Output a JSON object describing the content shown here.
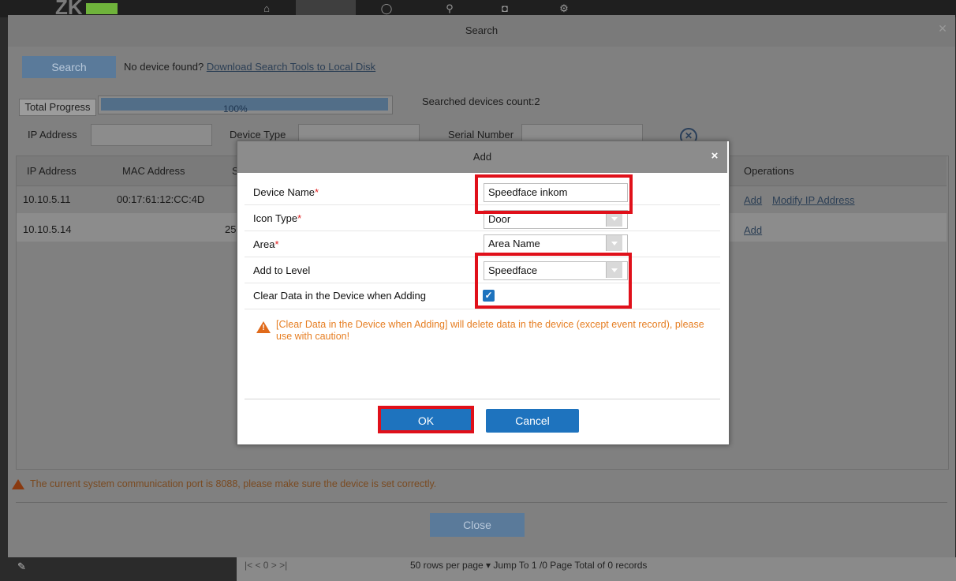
{
  "search_window": {
    "title": "Search",
    "close_glyph": "✕",
    "search_button": "Search",
    "no_device_text": "No device found?",
    "download_link": "Download Search Tools to Local Disk",
    "total_progress_label": "Total Progress",
    "progress_percent": "100%",
    "progress_value": 1.0,
    "searched_count": "Searched devices count:2",
    "filters": {
      "ip_label": "IP Address",
      "device_type_label": "Device Type",
      "serial_label": "Serial Number"
    },
    "table": {
      "headers": {
        "ip": "IP Address",
        "mac": "MAC Address",
        "s_partial": "S",
        "operations": "Operations"
      },
      "rows": [
        {
          "ip": "10.10.5.11",
          "mac": "00:17:61:12:CC:4D",
          "partial": "",
          "ops_add": "Add",
          "ops_modify": "Modify IP Address"
        },
        {
          "ip": "10.10.5.14",
          "mac": "",
          "partial": "25",
          "ops_add": "Add",
          "ops_modify": ""
        }
      ]
    },
    "port_warning": "The current system communication port is 8088, please make sure the device is set correctly.",
    "close_button": "Close"
  },
  "pager": {
    "nav": "|<   <     0     >   >|",
    "text": "50 rows per page  ▾     Jump To  1      /0 Page     Total of 0 records"
  },
  "add_dialog": {
    "title": "Add",
    "close_glyph": "×",
    "fields": {
      "device_name_label": "Device Name",
      "device_name_value": "Speedface inkom",
      "icon_type_label": "Icon Type",
      "icon_type_value": "Door",
      "area_label": "Area",
      "area_value": "Area Name",
      "level_label": "Add to Level",
      "level_value": "Speedface",
      "clear_data_label": "Clear Data in the Device when Adding",
      "clear_data_checked": true,
      "required_mark": "*"
    },
    "warning": "[Clear Data in the Device when Adding] will delete data in the device (except event record), please use with caution!",
    "ok_button": "OK",
    "cancel_button": "Cancel"
  },
  "colors": {
    "highlight": "#e0101a",
    "primary_button": "#1e73be",
    "warning_text": "#e67e22"
  }
}
